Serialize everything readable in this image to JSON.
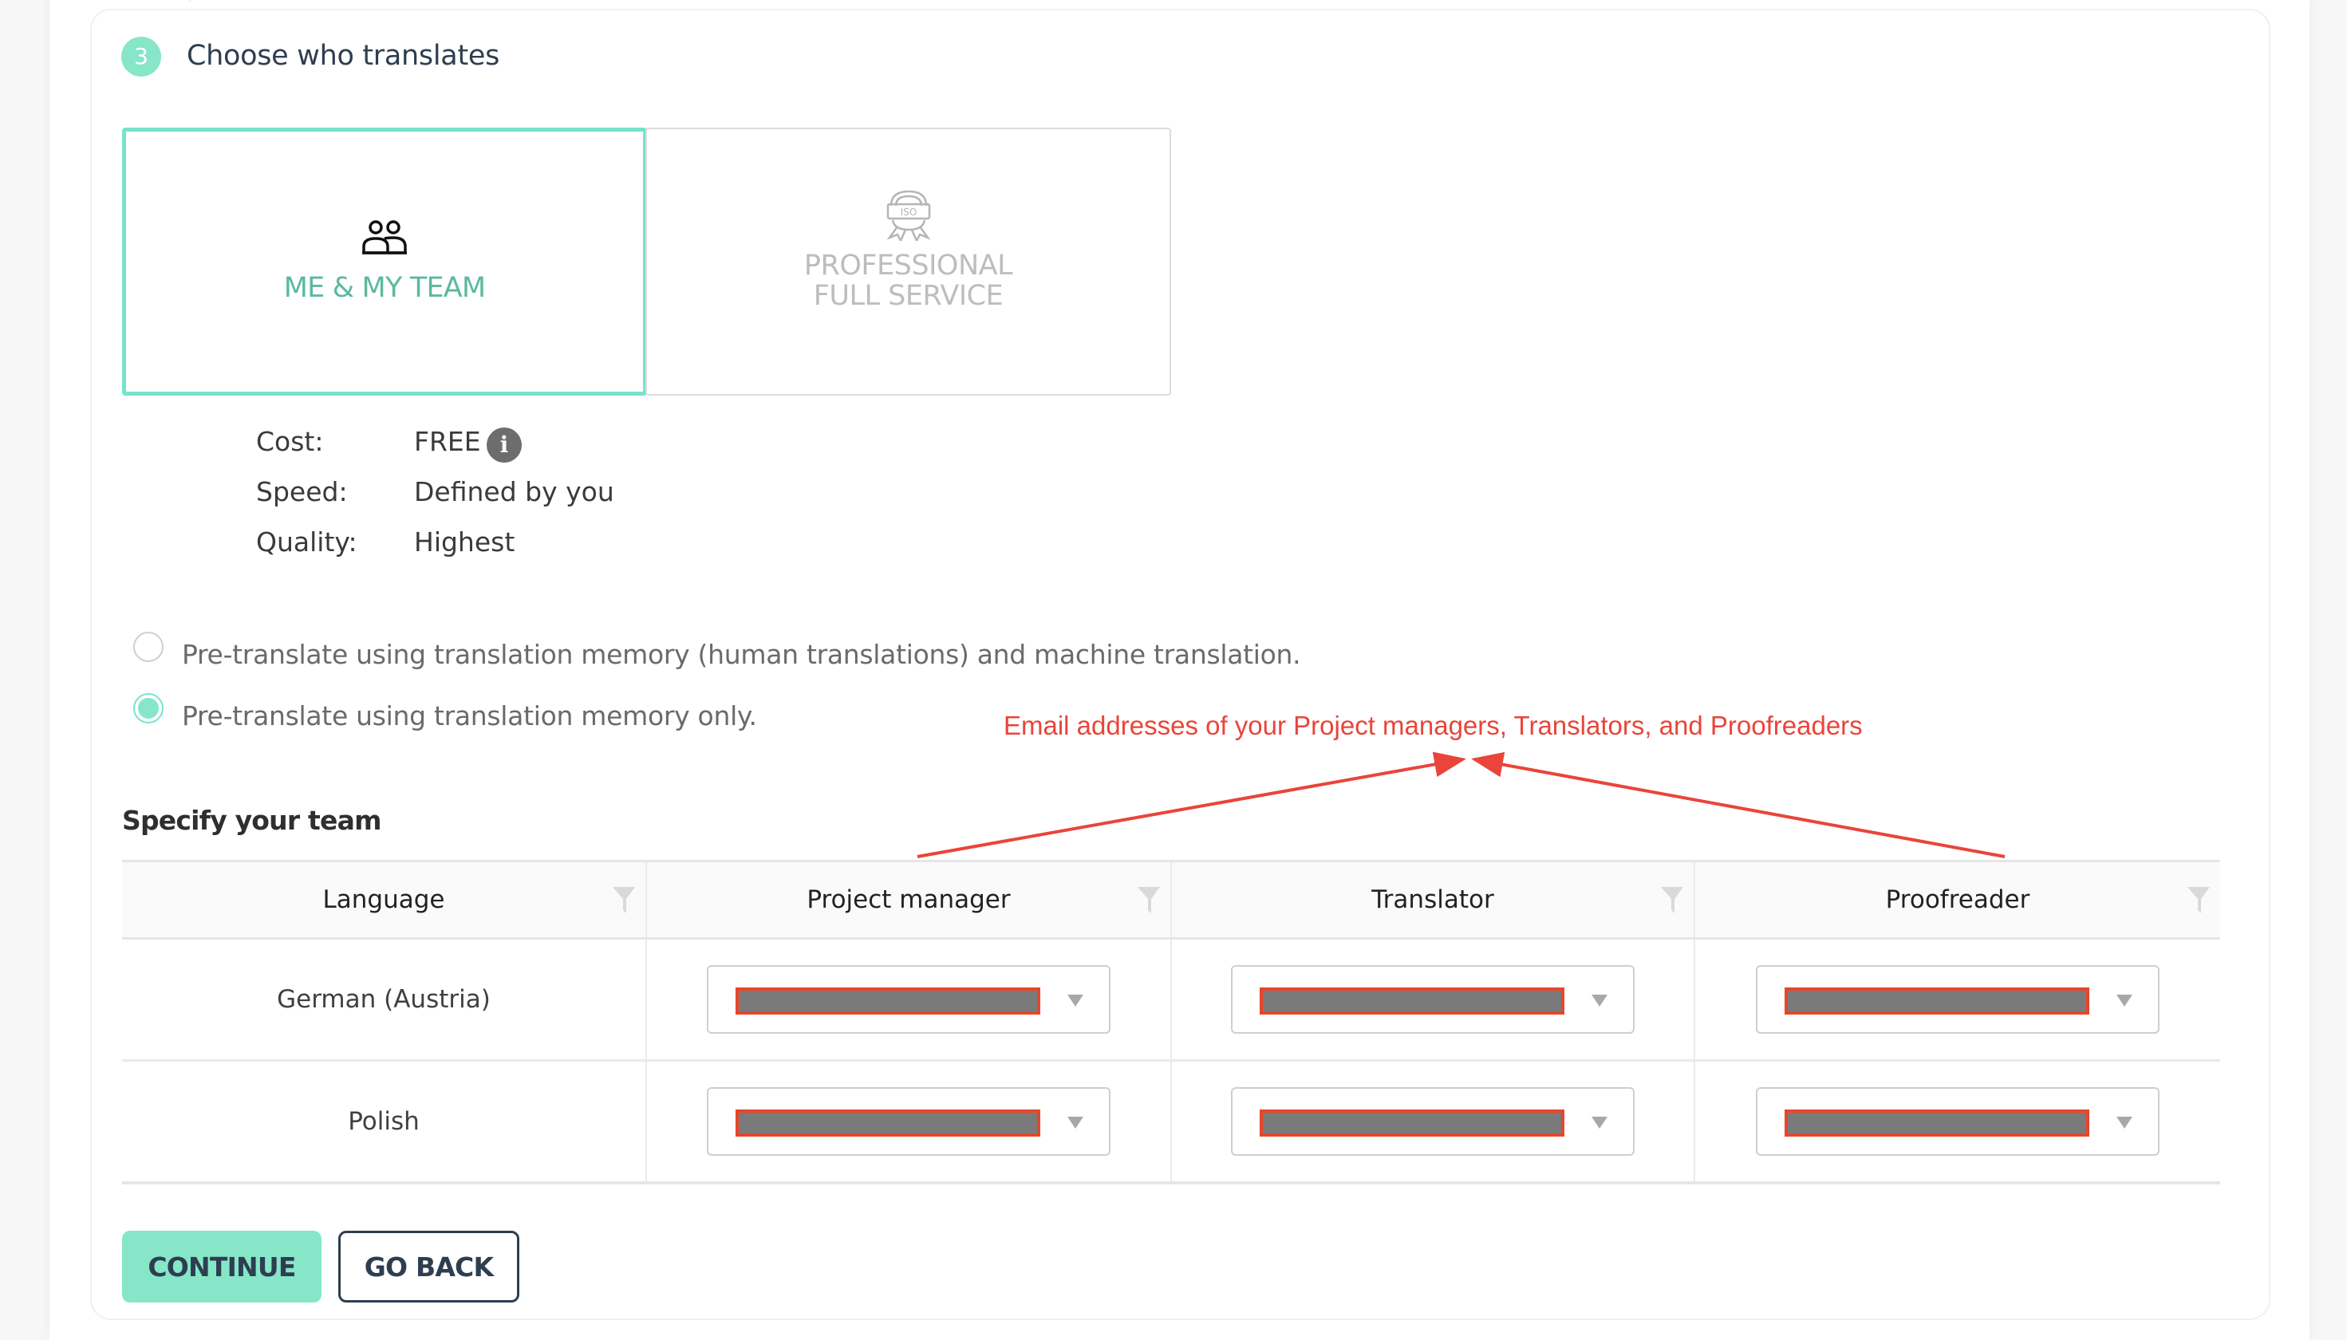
{
  "step": {
    "number": "3",
    "title": "Choose who translates"
  },
  "options": [
    {
      "id": "me-team",
      "label": "ME & MY TEAM",
      "icon": "team-icon",
      "selected": true
    },
    {
      "id": "professional",
      "label_line1": "PROFESSIONAL",
      "label_line2": "FULL SERVICE",
      "icon": "iso-badge-icon",
      "selected": false
    }
  ],
  "details": {
    "cost_label": "Cost:",
    "cost_value": "FREE",
    "cost_info_icon": "info-icon",
    "speed_label": "Speed:",
    "speed_value": "Defined by you",
    "quality_label": "Quality:",
    "quality_value": "Highest"
  },
  "pretranslate": {
    "options": [
      {
        "label": "Pre-translate using translation memory (human translations) and machine translation.",
        "checked": false
      },
      {
        "label": "Pre-translate using translation memory only.",
        "checked": true
      }
    ]
  },
  "annotation": {
    "text": "Email addresses of your Project managers, Translators, and Proofreaders",
    "color": "#e9453a"
  },
  "team": {
    "title": "Specify your team",
    "columns": [
      "Language",
      "Project manager",
      "Translator",
      "Proofreader"
    ],
    "rows": [
      {
        "language": "German (Austria)",
        "project_manager": "[redacted]",
        "translator": "[redacted]",
        "proofreader": "[redacted]"
      },
      {
        "language": "Polish",
        "project_manager": "[redacted]",
        "translator": "[redacted]",
        "proofreader": "[redacted]"
      }
    ]
  },
  "buttons": {
    "continue": "CONTINUE",
    "go_back": "GO BACK"
  },
  "colors": {
    "accent": "#86e6c7",
    "accent_border": "#77e3cd",
    "accent_text": "#5cb8a0",
    "dark_text": "#2d3e50",
    "redaction": "#7a7a7a",
    "redaction_border": "#e8452a"
  }
}
